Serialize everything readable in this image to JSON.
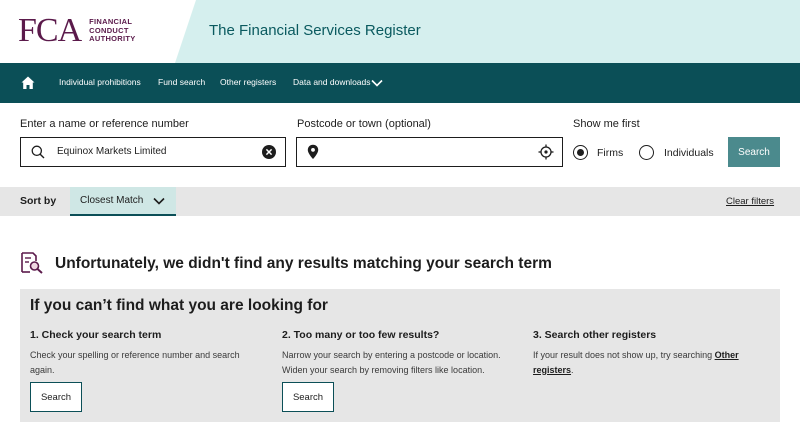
{
  "header": {
    "logo_mark": "FCA",
    "logo_text_lines": [
      "FINANCIAL",
      "CONDUCT",
      "AUTHORITY"
    ],
    "site_title": "The Financial Services Register",
    "band_color": "#d5efee"
  },
  "nav": {
    "home_icon": "home-icon",
    "items": [
      {
        "label": "Individual prohibitions"
      },
      {
        "label": "Fund search"
      },
      {
        "label": "Other registers"
      },
      {
        "label": "Data and downloads"
      }
    ]
  },
  "search": {
    "name_label": "Enter a name or reference number",
    "name_value": "Equinox Markets Limited",
    "postcode_label": "Postcode or town (optional)",
    "postcode_value": "",
    "show_me_first_label": "Show me first",
    "options": [
      {
        "label": "Firms",
        "checked": true
      },
      {
        "label": "Individuals",
        "checked": false
      }
    ],
    "search_button": "Search"
  },
  "sort": {
    "label": "Sort by",
    "value": "Closest Match",
    "clear_filters": "Clear filters"
  },
  "results": {
    "no_results_heading": "Unfortunately, we didn't find any results matching your search term"
  },
  "help_panel": {
    "title": "If you can’t find what you are looking for",
    "columns": [
      {
        "title": "1. Check your search term",
        "text_lines": [
          "Check your spelling or reference number and search",
          "again."
        ],
        "button": "Search"
      },
      {
        "title": "2. Too many or too few results?",
        "text_lines": [
          "Narrow your search by entering a postcode or location.",
          "Widen your search by removing filters like location."
        ],
        "button": "Search"
      },
      {
        "title": "3. Search other registers",
        "text_before_link": "If your result does not show up, try searching ",
        "link_part1": "Other",
        "link_part2": "registers",
        "text_after_link": "."
      }
    ]
  },
  "colors": {
    "brand_purple": "#5b1a4b",
    "nav_teal": "#0b4f57",
    "button_teal": "#4b8a8d",
    "sort_select_bg": "#cfe7e5",
    "panel_grey": "#e6e6e6"
  }
}
